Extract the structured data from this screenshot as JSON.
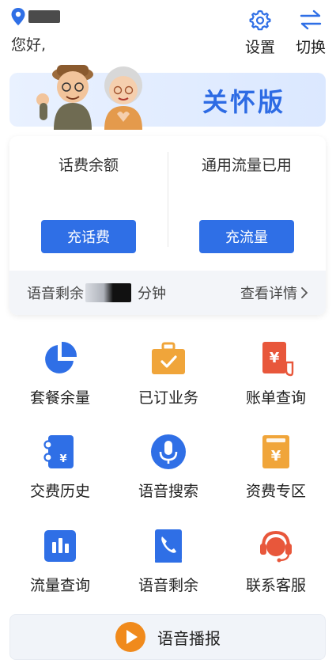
{
  "header": {
    "greeting": "您好,",
    "settings_label": "设置",
    "switch_label": "切换"
  },
  "banner": {
    "title": "关怀版"
  },
  "balance": {
    "fee_label": "话费余额",
    "data_label": "通用流量已用",
    "recharge_fee_button": "充话费",
    "recharge_data_button": "充流量",
    "voice_prefix": "语音剩余",
    "voice_unit": "分钟",
    "detail_link": "查看详情"
  },
  "grid": [
    {
      "label": "套餐余量",
      "icon": "pie-chart-icon",
      "color": "#2f6fe6"
    },
    {
      "label": "已订业务",
      "icon": "briefcase-check-icon",
      "color": "#f0a53a"
    },
    {
      "label": "账单查询",
      "icon": "bill-icon",
      "color": "#e8573b"
    },
    {
      "label": "交费历史",
      "icon": "payment-history-icon",
      "color": "#2f6fe6"
    },
    {
      "label": "语音搜索",
      "icon": "microphone-icon",
      "color": "#2f6fe6"
    },
    {
      "label": "资费专区",
      "icon": "tariff-icon",
      "color": "#f0a53a"
    },
    {
      "label": "流量查询",
      "icon": "bar-chart-icon",
      "color": "#2f6fe6"
    },
    {
      "label": "语音剩余",
      "icon": "phone-icon",
      "color": "#2f6fe6"
    },
    {
      "label": "联系客服",
      "icon": "headset-icon",
      "color": "#e8573b"
    }
  ],
  "voice_broadcast": {
    "label": "语音播报",
    "icon": "play-icon"
  },
  "colors": {
    "primary": "#2f6fe6",
    "orange": "#f0a53a",
    "red": "#e8573b"
  }
}
